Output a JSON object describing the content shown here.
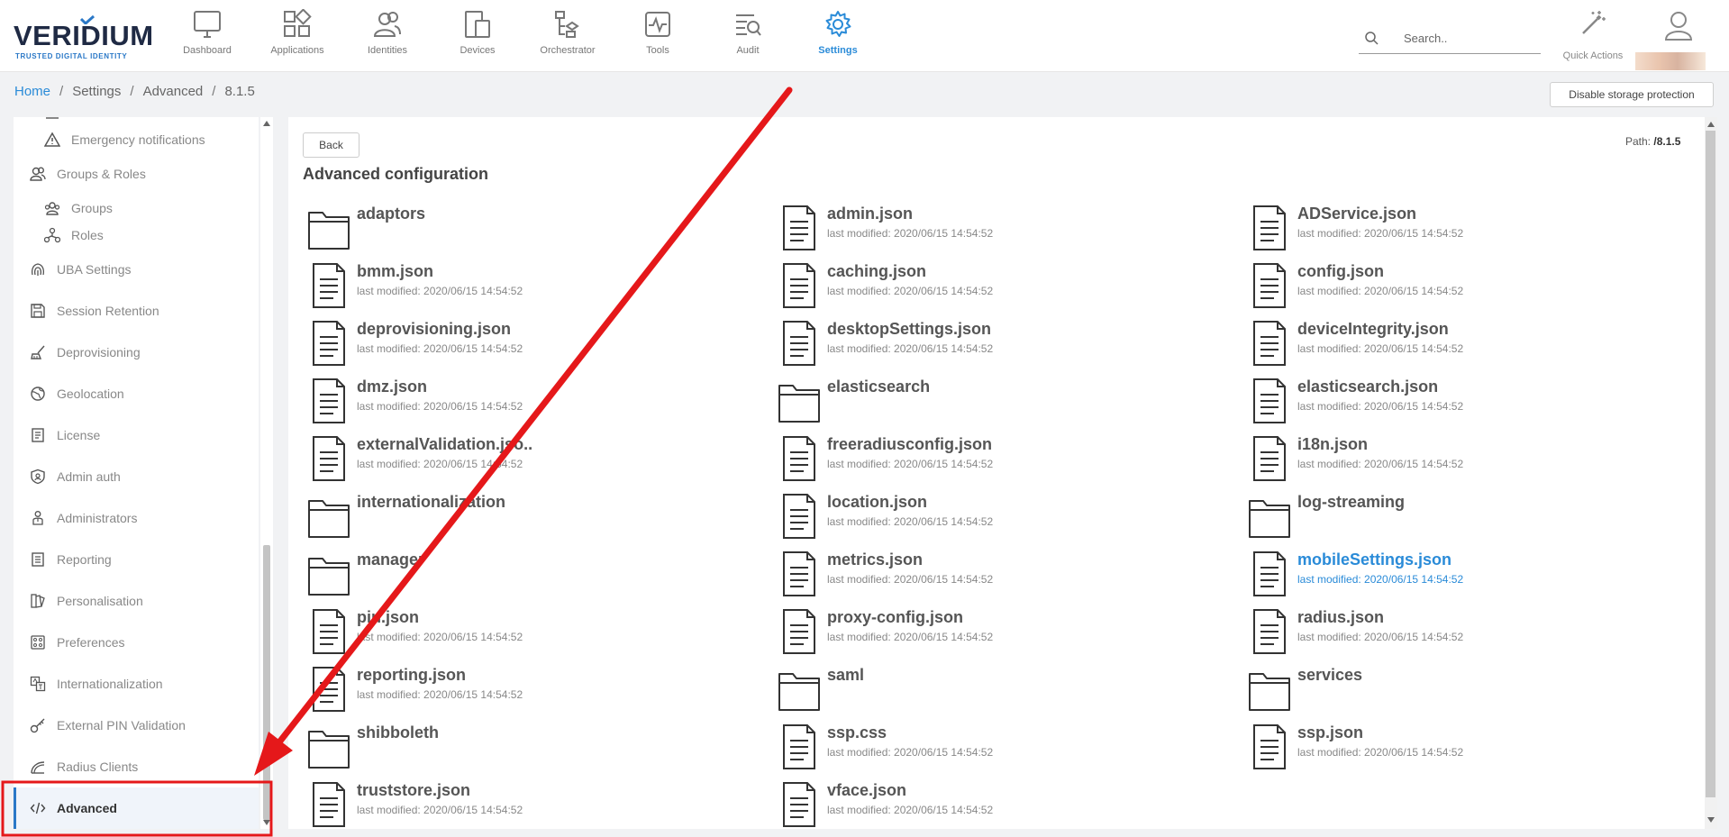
{
  "brand": {
    "name": "VERIDIUM",
    "tagline": "TRUSTED DIGITAL IDENTITY"
  },
  "nav": [
    {
      "label": "Dashboard",
      "icon": "monitor-icon"
    },
    {
      "label": "Applications",
      "icon": "apps-grid-icon"
    },
    {
      "label": "Identities",
      "icon": "users-icon"
    },
    {
      "label": "Devices",
      "icon": "devices-icon"
    },
    {
      "label": "Orchestrator",
      "icon": "orchestrator-icon"
    },
    {
      "label": "Tools",
      "icon": "pulse-icon"
    },
    {
      "label": "Audit",
      "icon": "audit-search-icon"
    },
    {
      "label": "Settings",
      "icon": "gear-icon",
      "active": true
    }
  ],
  "search": {
    "placeholder": "Search.."
  },
  "quick_actions": {
    "label": "Quick Actions"
  },
  "breadcrumb": {
    "home": "Home",
    "settings": "Settings",
    "advanced": "Advanced",
    "version": "8.1.5"
  },
  "header_button": "Disable storage protection",
  "sidebar": {
    "items": [
      {
        "label": "Emergency notifications",
        "icon": "warning-icon",
        "kind": "sub"
      },
      {
        "label": "Groups & Roles",
        "icon": "users-icon",
        "kind": "top"
      },
      {
        "label": "Groups",
        "icon": "group-icon",
        "kind": "sub"
      },
      {
        "label": "Roles",
        "icon": "roles-icon",
        "kind": "sub"
      },
      {
        "label": "UBA Settings",
        "icon": "fingerprint-icon",
        "kind": "top"
      },
      {
        "label": "Session Retention",
        "icon": "save-icon",
        "kind": "top"
      },
      {
        "label": "Deprovisioning",
        "icon": "broom-icon",
        "kind": "top"
      },
      {
        "label": "Geolocation",
        "icon": "globe-icon",
        "kind": "top"
      },
      {
        "label": "License",
        "icon": "license-icon",
        "kind": "top"
      },
      {
        "label": "Admin auth",
        "icon": "shield-icon",
        "kind": "top"
      },
      {
        "label": "Administrators",
        "icon": "admin-icon",
        "kind": "top"
      },
      {
        "label": "Reporting",
        "icon": "report-icon",
        "kind": "top"
      },
      {
        "label": "Personalisation",
        "icon": "palette-icon",
        "kind": "top"
      },
      {
        "label": "Preferences",
        "icon": "preferences-icon",
        "kind": "top"
      },
      {
        "label": "Internationalization",
        "icon": "translate-icon",
        "kind": "top"
      },
      {
        "label": "External PIN Validation",
        "icon": "key-icon",
        "kind": "top"
      },
      {
        "label": "Radius Clients",
        "icon": "radius-icon",
        "kind": "top"
      },
      {
        "label": "Advanced",
        "icon": "code-icon",
        "kind": "top",
        "active": true
      }
    ]
  },
  "main": {
    "back_label": "Back",
    "path_label": "Path:",
    "path_value": "/8.1.5",
    "title": "Advanced configuration",
    "modified": "last modified: 2020/06/15 14:54:52",
    "entries": [
      {
        "name": "adaptors",
        "type": "folder"
      },
      {
        "name": "admin.json",
        "type": "file"
      },
      {
        "name": "ADService.json",
        "type": "file"
      },
      {
        "name": "bmm.json",
        "type": "file"
      },
      {
        "name": "caching.json",
        "type": "file"
      },
      {
        "name": "config.json",
        "type": "file"
      },
      {
        "name": "deprovisioning.json",
        "type": "file"
      },
      {
        "name": "desktopSettings.json",
        "type": "file"
      },
      {
        "name": "deviceIntegrity.json",
        "type": "file"
      },
      {
        "name": "dmz.json",
        "type": "file"
      },
      {
        "name": "elasticsearch",
        "type": "folder"
      },
      {
        "name": "elasticsearch.json",
        "type": "file"
      },
      {
        "name": "externalValidation.jso..",
        "type": "file"
      },
      {
        "name": "freeradiusconfig.json",
        "type": "file"
      },
      {
        "name": "i18n.json",
        "type": "file"
      },
      {
        "name": "internationalization",
        "type": "folder"
      },
      {
        "name": "location.json",
        "type": "file"
      },
      {
        "name": "log-streaming",
        "type": "folder"
      },
      {
        "name": "manager",
        "type": "folder"
      },
      {
        "name": "metrics.json",
        "type": "file"
      },
      {
        "name": "mobileSettings.json",
        "type": "file",
        "highlight": true
      },
      {
        "name": "pin.json",
        "type": "file"
      },
      {
        "name": "proxy-config.json",
        "type": "file"
      },
      {
        "name": "radius.json",
        "type": "file"
      },
      {
        "name": "reporting.json",
        "type": "file"
      },
      {
        "name": "saml",
        "type": "folder"
      },
      {
        "name": "services",
        "type": "folder"
      },
      {
        "name": "shibboleth",
        "type": "folder"
      },
      {
        "name": "ssp.css",
        "type": "file"
      },
      {
        "name": "ssp.json",
        "type": "file"
      },
      {
        "name": "truststore.json",
        "type": "file"
      },
      {
        "name": "vface.json",
        "type": "file"
      }
    ]
  },
  "colors": {
    "accent": "#2a8bd8",
    "annotation": "#e5181a"
  }
}
